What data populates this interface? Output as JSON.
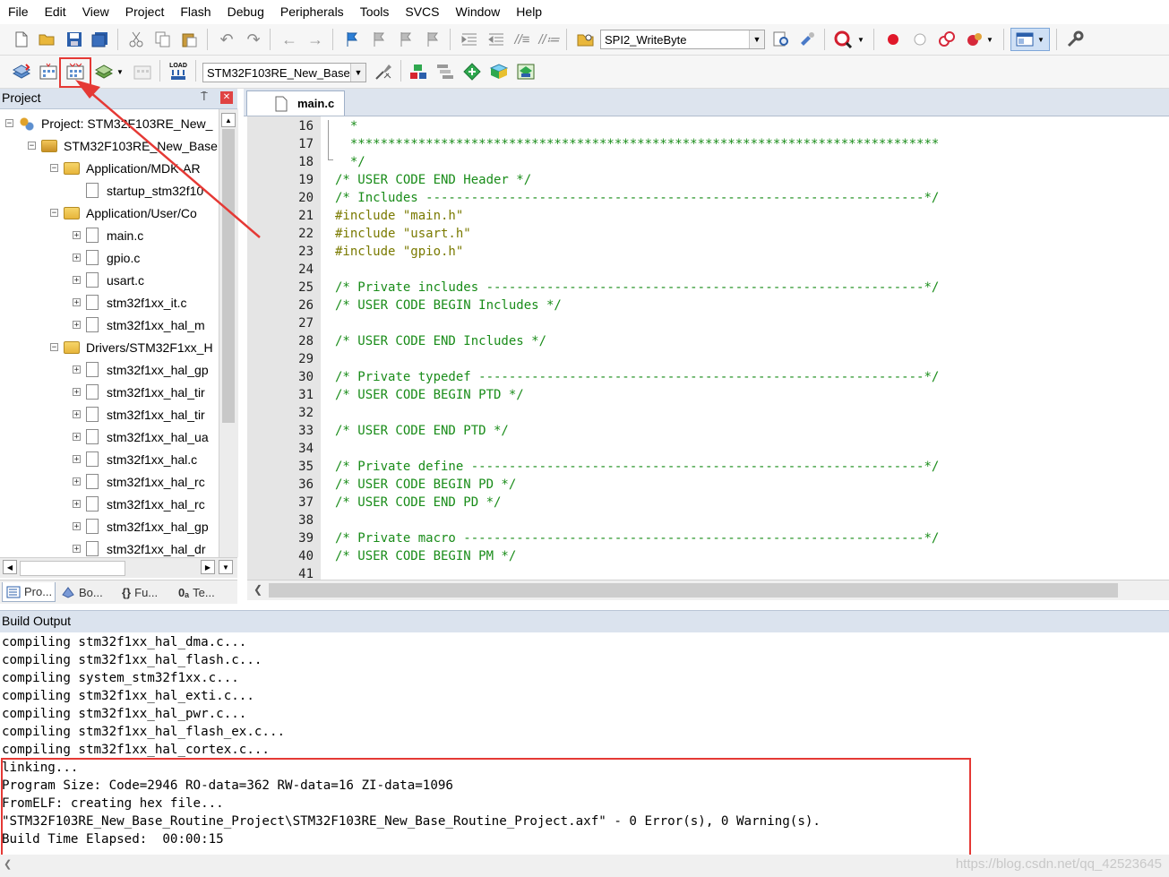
{
  "menu": [
    "File",
    "Edit",
    "View",
    "Project",
    "Flash",
    "Debug",
    "Peripherals",
    "Tools",
    "SVCS",
    "Window",
    "Help"
  ],
  "toolbar1": {
    "function_combo": "SPI2_WriteByte"
  },
  "toolbar2": {
    "target_combo": "STM32F103RE_New_Base",
    "load_label": "LOAD"
  },
  "project_panel": {
    "title": "Project",
    "pin_glyph": "⍑",
    "close_glyph": "✕",
    "tree": [
      {
        "label": "Project: STM32F103RE_New_",
        "expander": "−",
        "icon": "project"
      },
      {
        "label": "STM32F103RE_New_Base",
        "expander": "−",
        "icon": "target"
      },
      {
        "label": "Application/MDK-AR",
        "expander": "−",
        "icon": "folder"
      },
      {
        "label": "startup_stm32f10",
        "expander": "",
        "icon": "file"
      },
      {
        "label": "Application/User/Co",
        "expander": "−",
        "icon": "folder"
      },
      {
        "label": "main.c",
        "expander": "+",
        "icon": "file"
      },
      {
        "label": "gpio.c",
        "expander": "+",
        "icon": "file"
      },
      {
        "label": "usart.c",
        "expander": "+",
        "icon": "file"
      },
      {
        "label": "stm32f1xx_it.c",
        "expander": "+",
        "icon": "file"
      },
      {
        "label": "stm32f1xx_hal_m",
        "expander": "+",
        "icon": "file"
      },
      {
        "label": "Drivers/STM32F1xx_H",
        "expander": "−",
        "icon": "folder"
      },
      {
        "label": "stm32f1xx_hal_gp",
        "expander": "+",
        "icon": "file"
      },
      {
        "label": "stm32f1xx_hal_tir",
        "expander": "+",
        "icon": "file"
      },
      {
        "label": "stm32f1xx_hal_tir",
        "expander": "+",
        "icon": "file"
      },
      {
        "label": "stm32f1xx_hal_ua",
        "expander": "+",
        "icon": "file"
      },
      {
        "label": "stm32f1xx_hal.c",
        "expander": "+",
        "icon": "file"
      },
      {
        "label": "stm32f1xx_hal_rc",
        "expander": "+",
        "icon": "file"
      },
      {
        "label": "stm32f1xx_hal_rc",
        "expander": "+",
        "icon": "file"
      },
      {
        "label": "stm32f1xx_hal_gp",
        "expander": "+",
        "icon": "file"
      },
      {
        "label": "stm32f1xx_hal_dr",
        "expander": "+",
        "icon": "file"
      }
    ],
    "tabs": [
      "Pro...",
      "Bo...",
      "Fu...",
      "Te..."
    ],
    "tab_glyphs": [
      "",
      "",
      "{}",
      "0ₐ"
    ]
  },
  "editor": {
    "tab_label": "main.c",
    "lines": [
      {
        "n": "16",
        "text": "  *",
        "kind": "comment"
      },
      {
        "n": "17",
        "text": "  ******************************************************************************",
        "kind": "comment"
      },
      {
        "n": "18",
        "text": "  */",
        "kind": "comment"
      },
      {
        "n": "19",
        "text": "/* USER CODE END Header */",
        "kind": "comment"
      },
      {
        "n": "20",
        "text": "/* Includes ------------------------------------------------------------------*/",
        "kind": "comment"
      },
      {
        "n": "21",
        "text": "#include \"main.h\"",
        "kind": "pp"
      },
      {
        "n": "22",
        "text": "#include \"usart.h\"",
        "kind": "pp"
      },
      {
        "n": "23",
        "text": "#include \"gpio.h\"",
        "kind": "pp"
      },
      {
        "n": "24",
        "text": "",
        "kind": "comment"
      },
      {
        "n": "25",
        "text": "/* Private includes ----------------------------------------------------------*/",
        "kind": "comment"
      },
      {
        "n": "26",
        "text": "/* USER CODE BEGIN Includes */",
        "kind": "comment"
      },
      {
        "n": "27",
        "text": "",
        "kind": "comment"
      },
      {
        "n": "28",
        "text": "/* USER CODE END Includes */",
        "kind": "comment"
      },
      {
        "n": "29",
        "text": "",
        "kind": "comment"
      },
      {
        "n": "30",
        "text": "/* Private typedef -----------------------------------------------------------*/",
        "kind": "comment"
      },
      {
        "n": "31",
        "text": "/* USER CODE BEGIN PTD */",
        "kind": "comment"
      },
      {
        "n": "32",
        "text": "",
        "kind": "comment"
      },
      {
        "n": "33",
        "text": "/* USER CODE END PTD */",
        "kind": "comment"
      },
      {
        "n": "34",
        "text": "",
        "kind": "comment"
      },
      {
        "n": "35",
        "text": "/* Private define ------------------------------------------------------------*/",
        "kind": "comment"
      },
      {
        "n": "36",
        "text": "/* USER CODE BEGIN PD */",
        "kind": "comment"
      },
      {
        "n": "37",
        "text": "/* USER CODE END PD */",
        "kind": "comment"
      },
      {
        "n": "38",
        "text": "",
        "kind": "comment"
      },
      {
        "n": "39",
        "text": "/* Private macro -------------------------------------------------------------*/",
        "kind": "comment"
      },
      {
        "n": "40",
        "text": "/* USER CODE BEGIN PM */",
        "kind": "comment"
      },
      {
        "n": "41",
        "text": "",
        "kind": "comment"
      }
    ]
  },
  "build_output": {
    "title": "Build Output",
    "lines": [
      "compiling stm32f1xx_hal_dma.c...",
      "compiling stm32f1xx_hal_flash.c...",
      "compiling system_stm32f1xx.c...",
      "compiling stm32f1xx_hal_exti.c...",
      "compiling stm32f1xx_hal_pwr.c...",
      "compiling stm32f1xx_hal_flash_ex.c...",
      "compiling stm32f1xx_hal_cortex.c...",
      "linking...",
      "Program Size: Code=2946 RO-data=362 RW-data=16 ZI-data=1096",
      "FromELF: creating hex file...",
      "\"STM32F103RE_New_Base_Routine_Project\\STM32F103RE_New_Base_Routine_Project.axf\" - 0 Error(s), 0 Warning(s).",
      "Build Time Elapsed:  00:00:15"
    ]
  },
  "watermark": "https://blog.csdn.net/qq_42523645",
  "colors": {
    "comment": "#198c19",
    "preprocessor": "#7a7a00",
    "highlight": "#e53935",
    "panel_header": "#dbe3ee"
  }
}
